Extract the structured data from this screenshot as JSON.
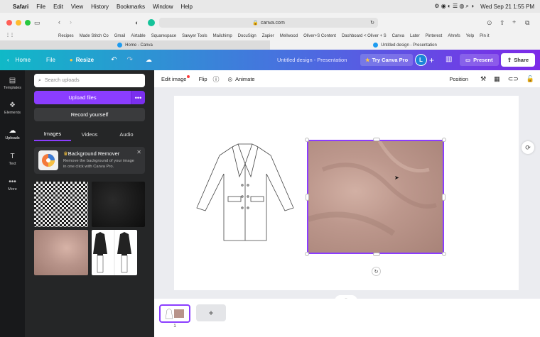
{
  "menubar": {
    "items": [
      "Safari",
      "File",
      "Edit",
      "View",
      "History",
      "Bookmarks",
      "Window",
      "Help"
    ],
    "datetime": "Wed Sep 21  1:55 PM"
  },
  "browser": {
    "url": "canva.com",
    "favorites": [
      "Recipes",
      "Made Stitch Co",
      "Gmail",
      "Airtable",
      "Squarespace",
      "Sawyer Tools",
      "Mailchimp",
      "DocuSign",
      "Zapier",
      "Mellwood",
      "Oliver+S Content",
      "Dashboard < Oliver + S",
      "Canva",
      "Later",
      "Pinterest",
      "Ahrefs",
      "Yelp",
      "Pin it"
    ],
    "tabs": [
      {
        "label": "Home - Canva",
        "active": false
      },
      {
        "label": "Untitled design - Presentation",
        "active": true
      }
    ]
  },
  "header": {
    "home": "Home",
    "file": "File",
    "resize": "Resize",
    "doc_title": "Untitled design - Presentation",
    "try_pro": "Try Canva Pro",
    "avatar": "L",
    "present": "Present",
    "share": "Share"
  },
  "rail": {
    "items": [
      {
        "label": "Templates",
        "icon": "templates-icon"
      },
      {
        "label": "Elements",
        "icon": "elements-icon"
      },
      {
        "label": "Uploads",
        "icon": "uploads-icon"
      },
      {
        "label": "Text",
        "icon": "text-icon"
      },
      {
        "label": "More",
        "icon": "more-icon"
      }
    ]
  },
  "panel": {
    "search_placeholder": "Search uploads",
    "upload_files": "Upload files",
    "record": "Record yourself",
    "tabs": [
      "Images",
      "Videos",
      "Audio"
    ],
    "promo": {
      "title": "Background Remover",
      "desc": "Remove the background of your image in one click with Canva Pro."
    }
  },
  "context_toolbar": {
    "edit_image": "Edit image",
    "flip": "Flip",
    "animate": "Animate",
    "position": "Position"
  },
  "pages": {
    "page_number": "1"
  },
  "colors": {
    "purple": "#8b3dff",
    "teal": "#10b9c7",
    "fabric": "#b8948a"
  }
}
